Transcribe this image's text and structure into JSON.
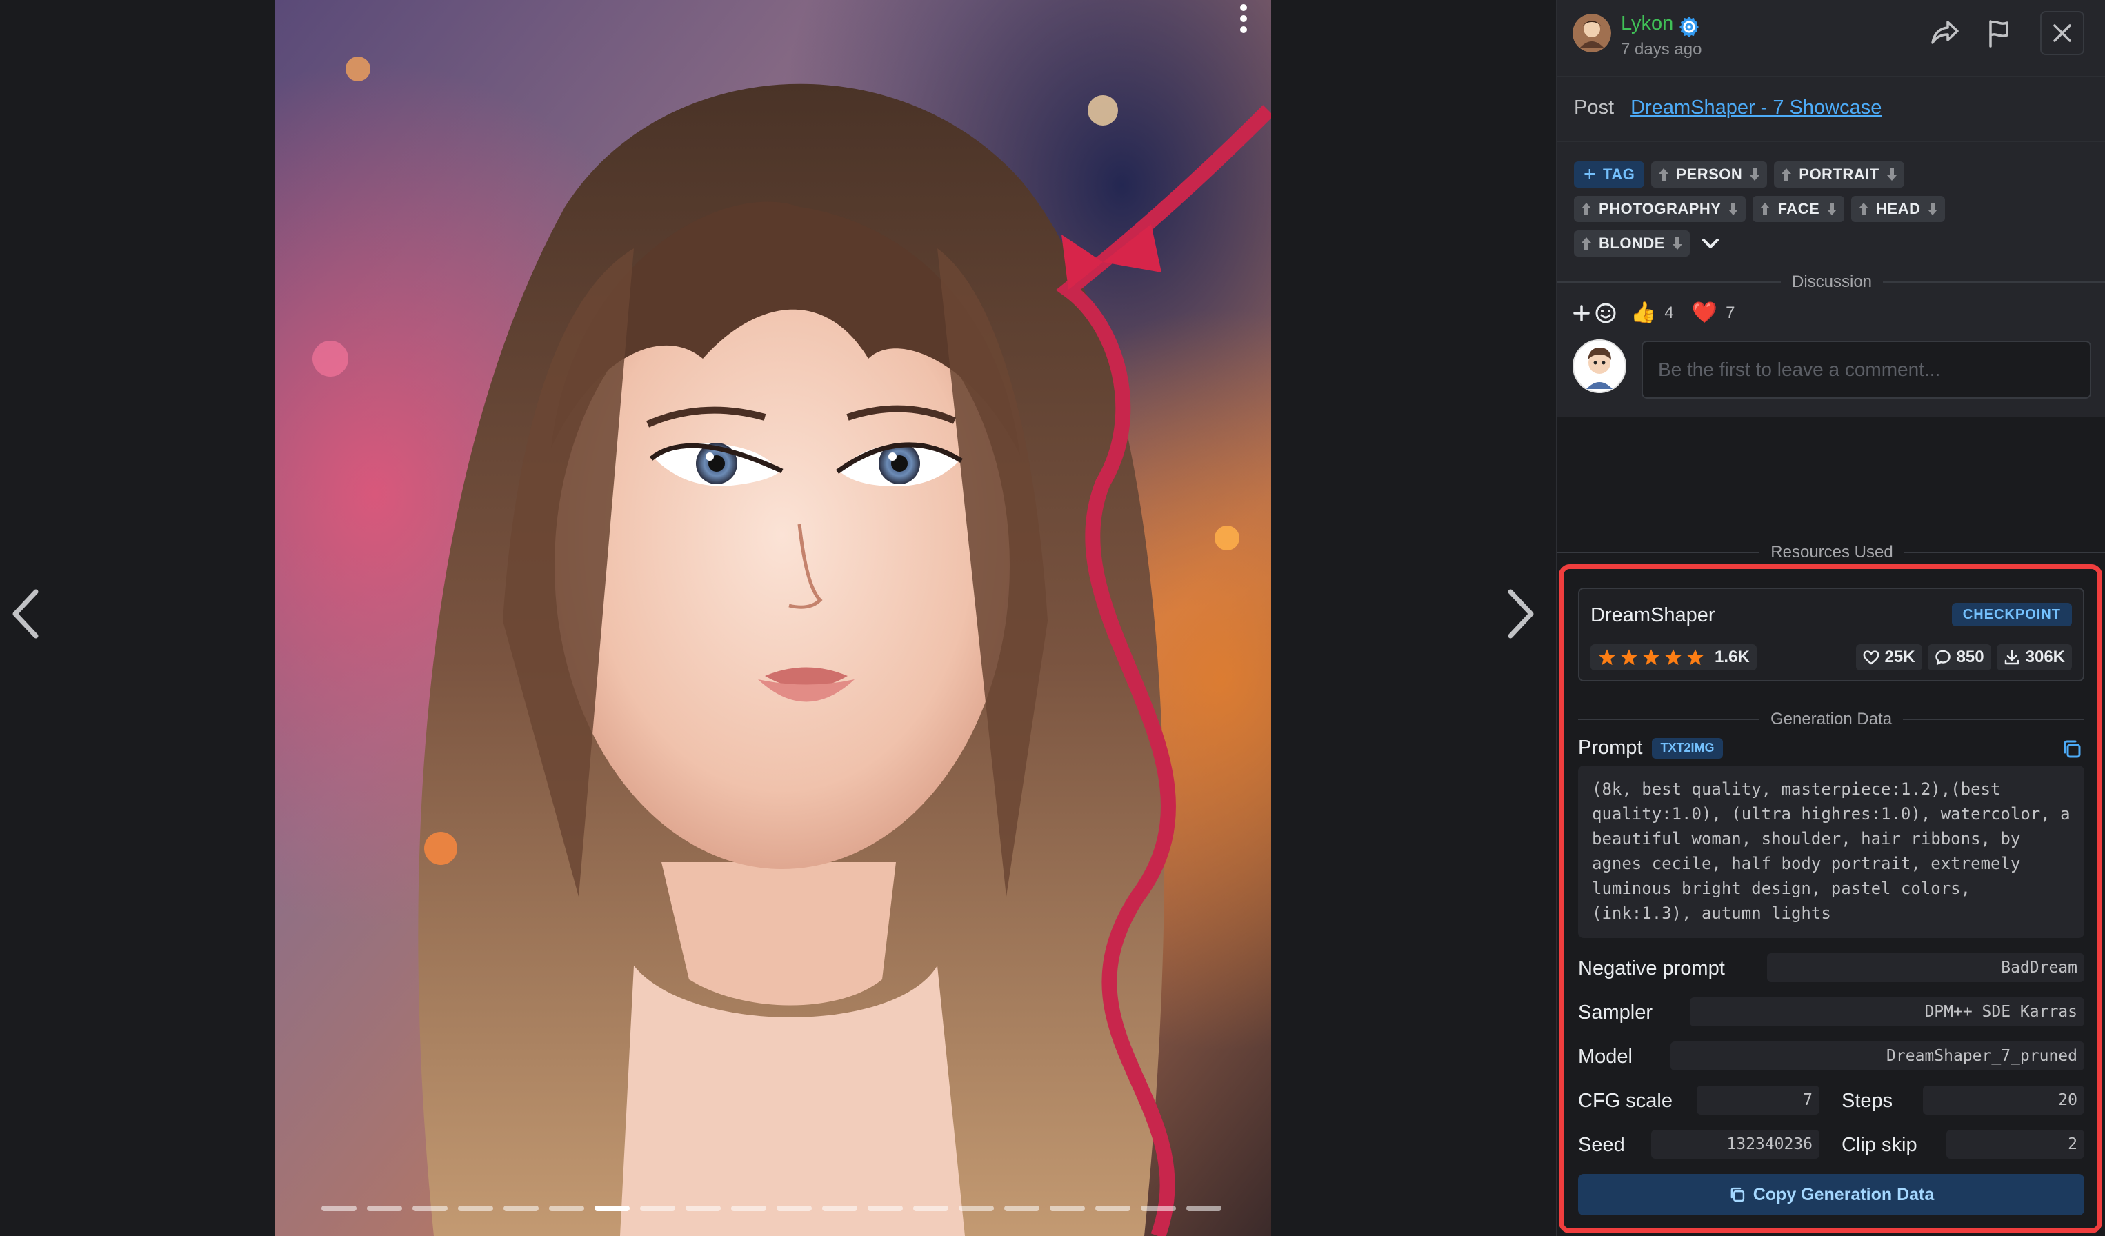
{
  "post": {
    "author": "Lykon",
    "time_ago": "7 days ago",
    "label": "Post",
    "link_text": "DreamShaper - 7 Showcase"
  },
  "tags": {
    "add_label": "TAG",
    "rows": [
      [
        "PERSON",
        "PORTRAIT"
      ],
      [
        "PHOTOGRAPHY",
        "FACE",
        "HEAD"
      ],
      [
        "BLONDE"
      ]
    ]
  },
  "discussion": {
    "label": "Discussion",
    "reactions": [
      {
        "emoji": "👍",
        "count": "4"
      },
      {
        "emoji": "❤️",
        "count": "7"
      }
    ],
    "comment_placeholder": "Be the first to leave a comment..."
  },
  "resources": {
    "label": "Resources Used",
    "name": "DreamShaper",
    "badge": "CHECKPOINT",
    "rating": 5,
    "rating_count": "1.6K",
    "likes": "25K",
    "comments": "850",
    "downloads": "306K"
  },
  "generation": {
    "label": "Generation Data",
    "prompt_label": "Prompt",
    "mode": "TXT2IMG",
    "prompt": "(8k, best quality, masterpiece:1.2),(best quality:1.0), (ultra highres:1.0), watercolor, a beautiful woman, shoulder, hair ribbons, by agnes cecile, half body portrait, extremely luminous bright design, pastel colors, (ink:1.3), autumn lights",
    "negative_label": "Negative prompt",
    "negative": "BadDream",
    "sampler_label": "Sampler",
    "sampler": "DPM++ SDE Karras",
    "model_label": "Model",
    "model": "DreamShaper_7_pruned",
    "cfg_label": "CFG scale",
    "cfg": "7",
    "steps_label": "Steps",
    "steps": "20",
    "seed_label": "Seed",
    "seed": "132340236",
    "clip_label": "Clip skip",
    "clip": "2",
    "copy_label": "Copy Generation Data"
  },
  "carousel": {
    "count": 20,
    "active_index": 6
  },
  "colors": {
    "accent": "#4dabf7",
    "username": "#40c057",
    "highlight": "#f03e3e",
    "star": "#fd7e14"
  }
}
